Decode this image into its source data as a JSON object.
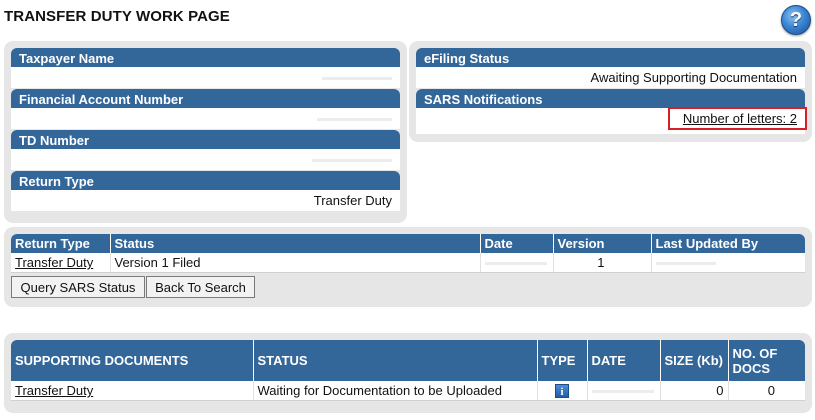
{
  "page": {
    "title": "TRANSFER DUTY WORK PAGE",
    "help_glyph": "?"
  },
  "taxpayer_panel": {
    "taxpayer_name_label": "Taxpayer Name",
    "taxpayer_name_value": "",
    "financial_account_label": "Financial Account Number",
    "td_number_label": "TD Number",
    "return_type_label": "Return Type",
    "return_type_value": "Transfer Duty"
  },
  "efiling_panel": {
    "efiling_status_label": "eFiling Status",
    "efiling_status_value": "Awaiting Supporting Documentation",
    "notifications_label": "SARS Notifications",
    "letters_link": "Number of letters: 2"
  },
  "returns_table": {
    "headers": [
      "Return Type",
      "Status",
      "Date",
      "Version",
      "Last Updated By"
    ],
    "rows": [
      {
        "return_type": "Transfer Duty",
        "status": "Version 1 Filed",
        "date": "",
        "version": "1",
        "last_updated_by": ""
      }
    ],
    "query_button": "Query SARS Status",
    "back_button": "Back To Search"
  },
  "documents_table": {
    "headers": [
      "SUPPORTING DOCUMENTS",
      "STATUS",
      "TYPE",
      "DATE",
      "SIZE (Kb)",
      "NO. OF DOCS"
    ],
    "rows": [
      {
        "document": "Transfer Duty",
        "status": "Waiting for Documentation to be Uploaded",
        "type_icon": "info-icon",
        "date": "",
        "size": "0",
        "docs": "0"
      }
    ]
  },
  "colors": {
    "header_blue": "#336699",
    "panel_grey": "#e6e6e6",
    "highlight_red": "#d42027"
  }
}
